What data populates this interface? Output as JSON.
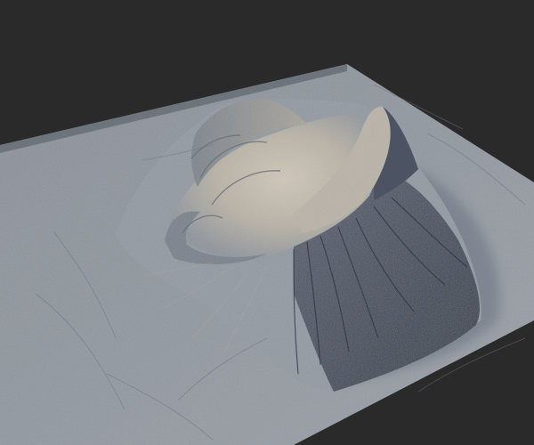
{
  "scene": {
    "subject": "terrain-heightmap-render",
    "colors": {
      "background": "#2a2a2a",
      "terrain_base": "#8f959d",
      "terrain_light": "#c9c2b4",
      "terrain_shadow": "#3e4656",
      "terrain_edge": "#5f656d"
    }
  }
}
